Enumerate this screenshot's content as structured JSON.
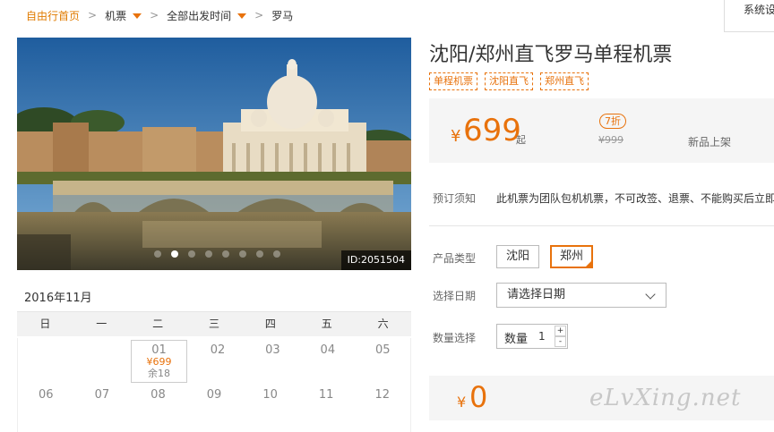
{
  "breadcrumb": {
    "home": "自由行首页",
    "category": "机票",
    "departure_time": "全部出发时间",
    "destination": "罗马"
  },
  "system_link": "系统设",
  "hero": {
    "photo_id": "ID:2051504",
    "slide_count": 8,
    "active_slide": 2
  },
  "calendar": {
    "month_tab": "2016年11月",
    "weekdays": [
      "日",
      "一",
      "二",
      "三",
      "四",
      "五",
      "六"
    ],
    "rows": [
      [
        {
          "day": ""
        },
        {
          "day": ""
        },
        {
          "day": "01",
          "price": "¥699",
          "remaining": "余18"
        },
        {
          "day": "02"
        },
        {
          "day": "03"
        },
        {
          "day": "04"
        },
        {
          "day": "05"
        }
      ],
      [
        {
          "day": "06"
        },
        {
          "day": "07"
        },
        {
          "day": "08"
        },
        {
          "day": "09"
        },
        {
          "day": "10"
        },
        {
          "day": "11"
        },
        {
          "day": "12"
        }
      ]
    ]
  },
  "product": {
    "title": "沈阳/郑州直飞罗马单程机票",
    "tags": [
      "单程机票",
      "沈阳直飞",
      "郑州直飞"
    ],
    "currency": "¥",
    "price": "699",
    "price_suffix": "起",
    "discount": "7折",
    "original_price": "¥999",
    "new_label": "新品上架",
    "notice_label": "预订须知",
    "notice_text": "此机票为团队包机机票，不可改签、退票、不能购买后立即",
    "type_label": "产品类型",
    "type_options": [
      "沈阳",
      "郑州"
    ],
    "selected_type": "郑州",
    "date_label": "选择日期",
    "date_placeholder": "请选择日期",
    "qty_label": "数量选择",
    "qty_inner_label": "数量",
    "qty_value": "1",
    "qty_plus": "+",
    "qty_minus": "-",
    "total_currency": "¥",
    "total_value": "0"
  },
  "watermark": "eLvXing.net",
  "colors": {
    "accent": "#e8720c",
    "panel_bg": "#f5f5f5"
  }
}
